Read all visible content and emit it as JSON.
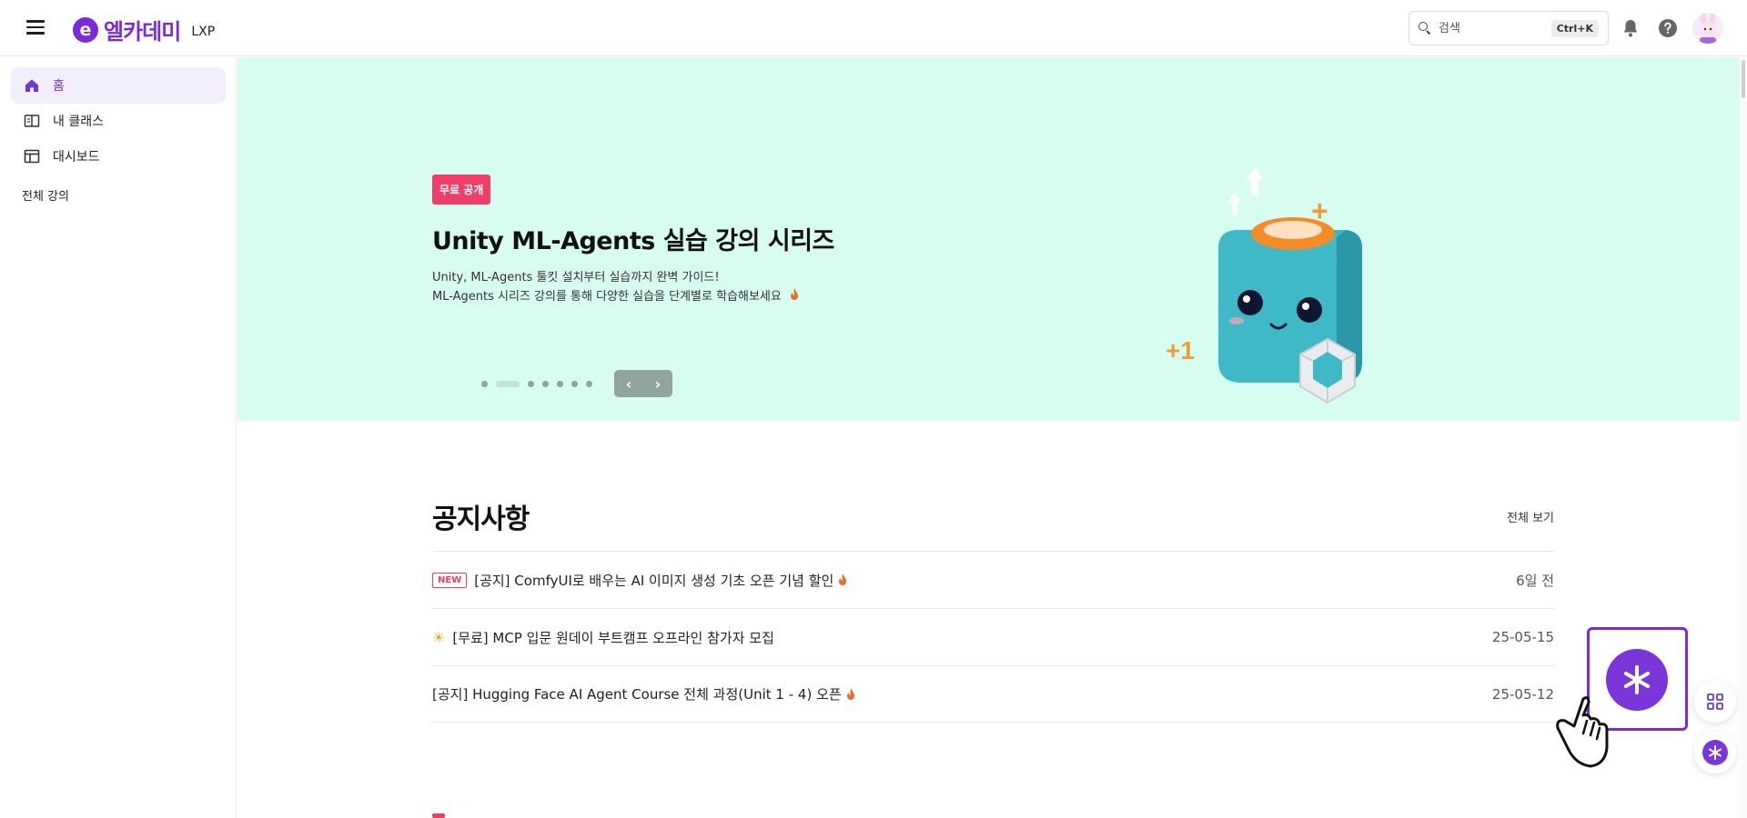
{
  "header": {
    "logo_mark": "e",
    "logo_text": "엘카데미",
    "logo_sub": "LXP",
    "search_placeholder": "검색",
    "search_shortcut": "Ctrl+K"
  },
  "sidebar": {
    "items": [
      {
        "label": "홈",
        "icon": "home-icon",
        "active": true
      },
      {
        "label": "내 클래스",
        "icon": "book-icon",
        "active": false
      },
      {
        "label": "대시보드",
        "icon": "dashboard-icon",
        "active": false
      }
    ],
    "section": "전체 강의"
  },
  "banner": {
    "badge": "무료 공개",
    "title": "Unity ML-Agents 실습 강의 시리즈",
    "desc_line1": "Unity, ML-Agents 툴킷 설치부터 실습까지 완벽 가이드!",
    "desc_line2": "ML-Agents 시리즈 강의를 통해 다양한 실습을 단계별로 학습해보세요",
    "slide_count": 7,
    "active_slide": 2,
    "illustration_plus": "+",
    "illustration_plus1": "+1",
    "bg_color": "#d7fdf0"
  },
  "notices": {
    "title": "공지사항",
    "see_all": "전체 보기",
    "items": [
      {
        "tag": "NEW",
        "label": "[공지] ComfyUI로 배우는 AI 이미지 생성 기초 오픈 기념 할인",
        "fire": true,
        "date": "6일 전"
      },
      {
        "prefix_icon": "sun-icon",
        "label": "[무료] MCP 입문 원데이 부트캠프 오프라인 참가자 모집",
        "fire": false,
        "date": "25-05-15"
      },
      {
        "label": "[공지] Hugging Face AI Agent Course 전체 과정(Unit 1 - 4) 오픈",
        "fire": true,
        "date": "25-05-12"
      }
    ]
  },
  "colors": {
    "brand": "#7a2bdc",
    "badge_red": "#f03e6a",
    "accent_active_bg": "#f2eefd"
  }
}
